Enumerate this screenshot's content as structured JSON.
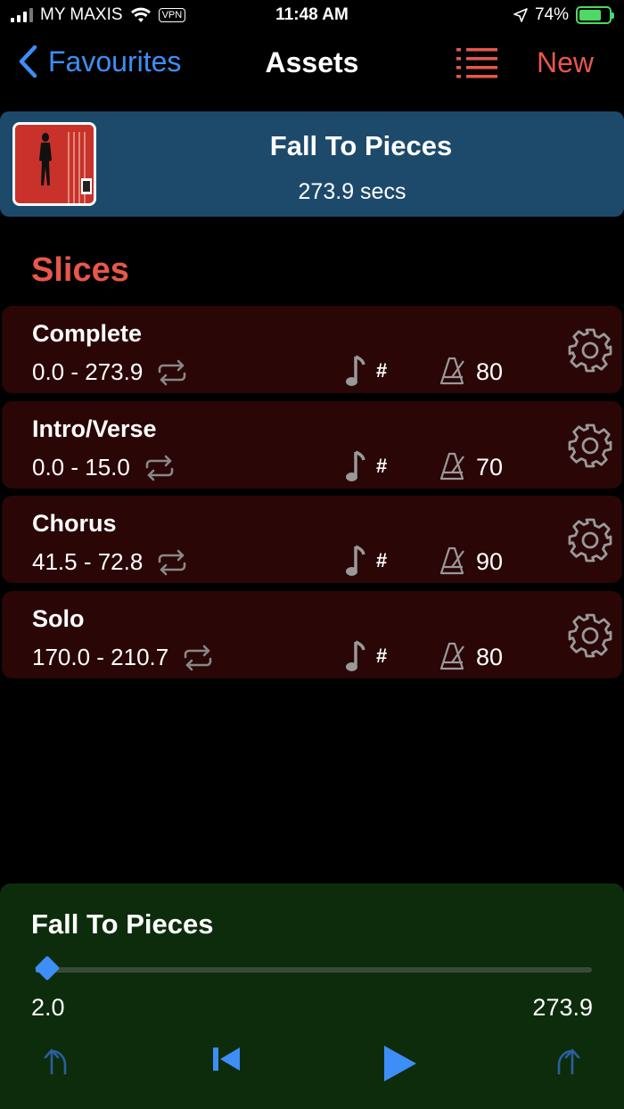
{
  "status": {
    "carrier": "MY MAXIS",
    "vpn": "VPN",
    "time": "11:48 AM",
    "battery": "74%"
  },
  "nav": {
    "back_label": "Favourites",
    "title": "Assets",
    "new_label": "New"
  },
  "asset": {
    "title": "Fall To Pieces",
    "duration": "273.9 secs"
  },
  "section": {
    "title": "Slices"
  },
  "slices": [
    {
      "name": "Complete",
      "range": "0.0 - 273.9",
      "key": "#",
      "tempo": "80"
    },
    {
      "name": "Intro/Verse",
      "range": "0.0 - 15.0",
      "key": "#",
      "tempo": "70"
    },
    {
      "name": "Chorus",
      "range": "41.5 - 72.8",
      "key": "#",
      "tempo": "90"
    },
    {
      "name": "Solo",
      "range": "170.0 - 210.7",
      "key": "#",
      "tempo": "80"
    }
  ],
  "player": {
    "title": "Fall To Pieces",
    "start": "2.0",
    "end": "273.9",
    "progress": 0.0073
  },
  "colors": {
    "accent_blue": "#3e8ef7",
    "accent_red": "#e8574a",
    "asset_bg": "#1d4a6b",
    "slice_bg": "#2a0606",
    "player_bg": "#0d2c0c"
  }
}
